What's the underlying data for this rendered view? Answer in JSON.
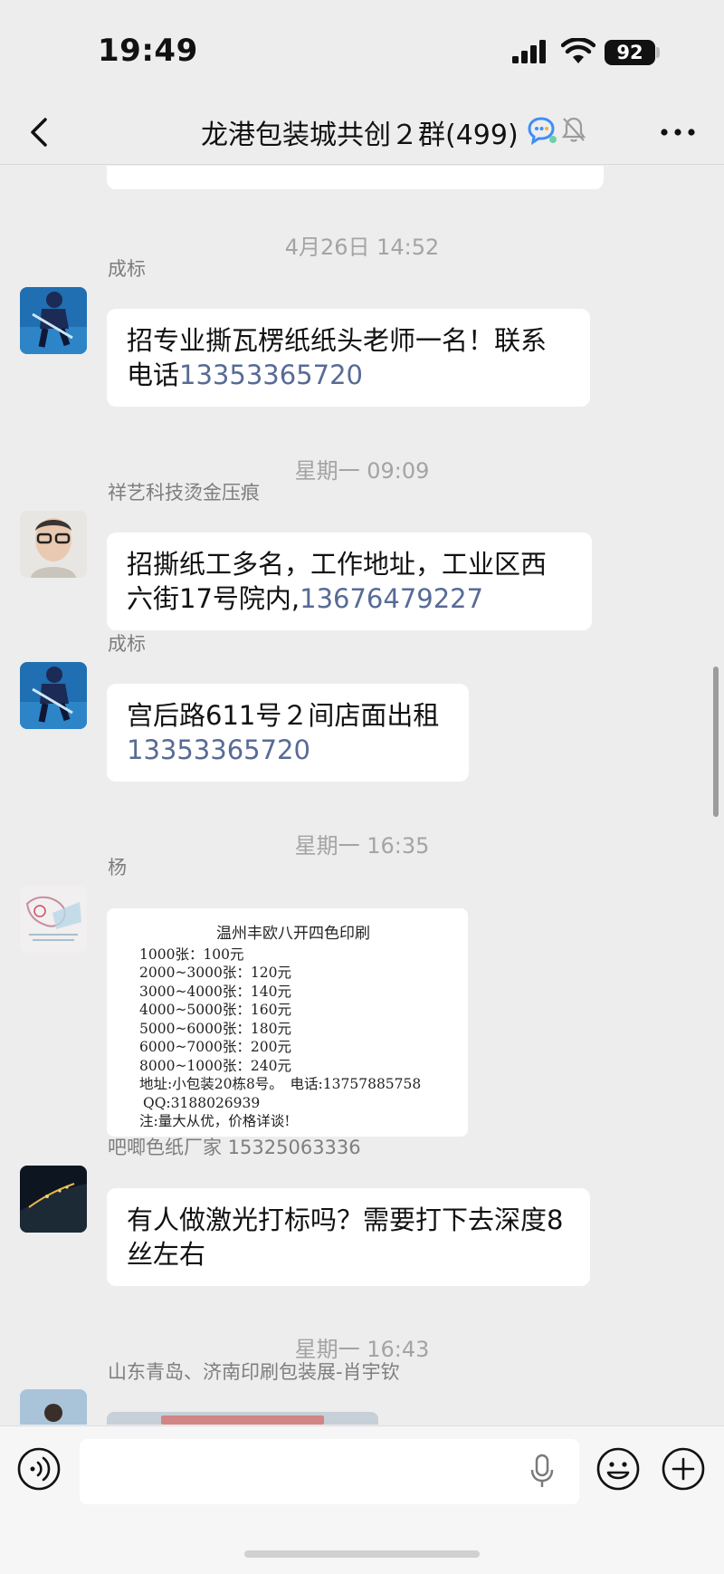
{
  "status_bar": {
    "time": "19:49",
    "battery": "92",
    "icons": [
      "signal-icon",
      "wifi-icon",
      "battery-icon"
    ]
  },
  "nav": {
    "title": "龙港包装城共创２群(499)",
    "icons": [
      "back-icon",
      "chat-bubble-icon",
      "mute-bell-icon",
      "more-icon"
    ]
  },
  "messages": {
    "sep1": "4月26日 14:52",
    "m1": {
      "sender": "成标",
      "text": "招专业撕瓦楞纸纸头老师一名！联系电话",
      "phone": "13353365720"
    },
    "sep2": "星期一 09:09",
    "m2": {
      "sender": "祥艺科技烫金压痕",
      "text": "招撕纸工多名，工作地址，工业区西六街17号院内,",
      "phone": "13676479227"
    },
    "m3": {
      "sender": "成标",
      "text": "宫后路611号２间店面出租",
      "phone": "13353365720"
    },
    "sep3": "星期一 16:35",
    "m4": {
      "sender": "杨",
      "image_lines": [
        "温州丰欧八开四色印刷",
        "1000张：100元",
        "2000~3000张：120元",
        "3000~4000张：140元",
        "4000~5000张：160元",
        "5000~6000张：180元",
        "6000~7000张：200元",
        "8000~1000张：240元",
        "地址:小包装20栋8号。　电话:13757885758",
        "QQ:3188026939",
        "注:量大从优，价格详谈!"
      ]
    },
    "m5": {
      "sender": "吧唧色纸厂家 15325063336",
      "text": "有人做激光打标吗？需要打下去深度8丝左右"
    },
    "sep4": "星期一 16:43",
    "m6": {
      "sender": "山东青岛、济南印刷包装展-肖宇钦"
    }
  },
  "colors": {
    "background": "#ededed",
    "bubble": "#ffffff",
    "link": "#576b95",
    "timestamp": "#a4a4a4"
  }
}
